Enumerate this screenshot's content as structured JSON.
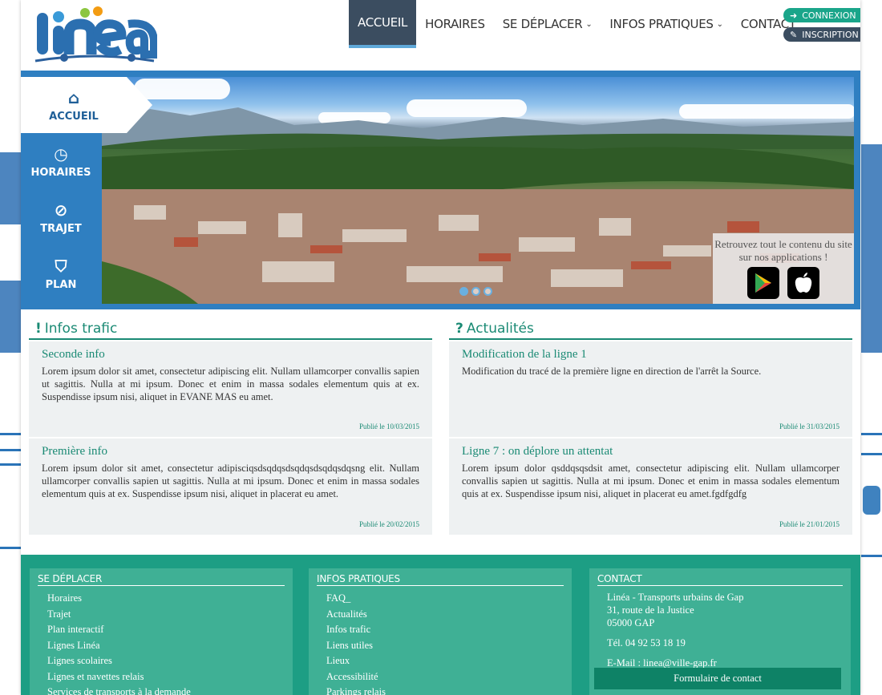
{
  "header": {
    "logo_text": "linéa",
    "nav": [
      {
        "label": "ACCUEIL",
        "active": true,
        "dropdown": false
      },
      {
        "label": "HORAIRES",
        "active": false,
        "dropdown": false
      },
      {
        "label": "SE DÉPLACER",
        "active": false,
        "dropdown": true
      },
      {
        "label": "INFOS PRATIQUES",
        "active": false,
        "dropdown": true
      },
      {
        "label": "CONTACT",
        "active": false,
        "dropdown": false
      }
    ],
    "login_label": "CONNEXION",
    "register_label": "INSCRIPTION"
  },
  "side_menu": [
    {
      "label": "ACCUEIL",
      "icon": "home-icon",
      "active": true
    },
    {
      "label": "HORAIRES",
      "icon": "clock-icon",
      "active": false
    },
    {
      "label": "TRAJET",
      "icon": "compass-icon",
      "active": false
    },
    {
      "label": "PLAN",
      "icon": "road-icon",
      "active": false
    }
  ],
  "banner": {
    "apps_text": "Retrouvez tout le contenu du site sur nos applications !",
    "apps": [
      "google-play-icon",
      "apple-icon"
    ],
    "slides": 3,
    "active_slide": 0
  },
  "infos_trafic": {
    "title": "Infos trafic",
    "items": [
      {
        "title": "Seconde info",
        "body": "Lorem ipsum dolor sit amet, consectetur adipiscing elit. Nullam ullamcorper convallis sapien ut sagittis. Nulla at mi ipsum. Donec et enim in massa sodales elementum quis at ex. Suspendisse ipsum nisi, aliquet in EVANE MAS eu amet.",
        "date": "Publié le 10/03/2015"
      },
      {
        "title": "Première info",
        "body": "Lorem ipsum dolor sit amet, consectetur adipisciqsdsqdqsdsqdqsdsqdqsdqsng elit. Nullam ullamcorper convallis sapien ut sagittis. Nulla at mi ipsum. Donec et enim in massa sodales elementum quis at ex. Suspendisse ipsum nisi, aliquet in placerat eu amet.",
        "date": "Publié le 20/02/2015"
      }
    ]
  },
  "actualites": {
    "title": "Actualités",
    "items": [
      {
        "title": "Modification de la ligne 1",
        "body": "Modification du tracé de la première ligne en direction de l'arrêt la Source.",
        "date": "Publié le 31/03/2015"
      },
      {
        "title": "Ligne 7 : on déplore un attentat",
        "body": "Lorem ipsum dolor qsddqsqsdsit amet, consectetur adipiscing elit. Nullam ullamcorper convallis sapien ut sagittis. Nulla at mi ipsum. Donec et enim in massa sodales elementum quis at ex. Suspendisse ipsum nisi, aliquet in placerat eu amet.fgdfgdfg",
        "date": "Publié le 21/01/2015"
      }
    ]
  },
  "footer": {
    "se_deplacer": {
      "title": "SE DÉPLACER",
      "links": [
        "Horaires",
        "Trajet",
        "Plan interactif",
        "Lignes Linéa",
        "Lignes scolaires",
        "Lignes et navettes relais",
        "Services de transports à la demande"
      ]
    },
    "infos_pratiques": {
      "title": "INFOS PRATIQUES",
      "links": [
        "FAQ_",
        "Actualités",
        "Infos trafic",
        "Liens utiles",
        "Lieux",
        "Accessibilité",
        "Parkings relais"
      ]
    },
    "contact": {
      "title": "CONTACT",
      "name": "Linéa - Transports urbains de Gap",
      "street": "31, route de la Justice",
      "city": "05000 GAP",
      "phone": "Tél. 04 92 53 18 19",
      "email": "E-Mail : linea@ville-gap.fr",
      "form_label": "Formulaire de contact"
    }
  },
  "colors": {
    "green": "#1a8a74",
    "dark": "#3b4d60",
    "blue": "#2f7fc1",
    "footer": "#1d9e84"
  }
}
